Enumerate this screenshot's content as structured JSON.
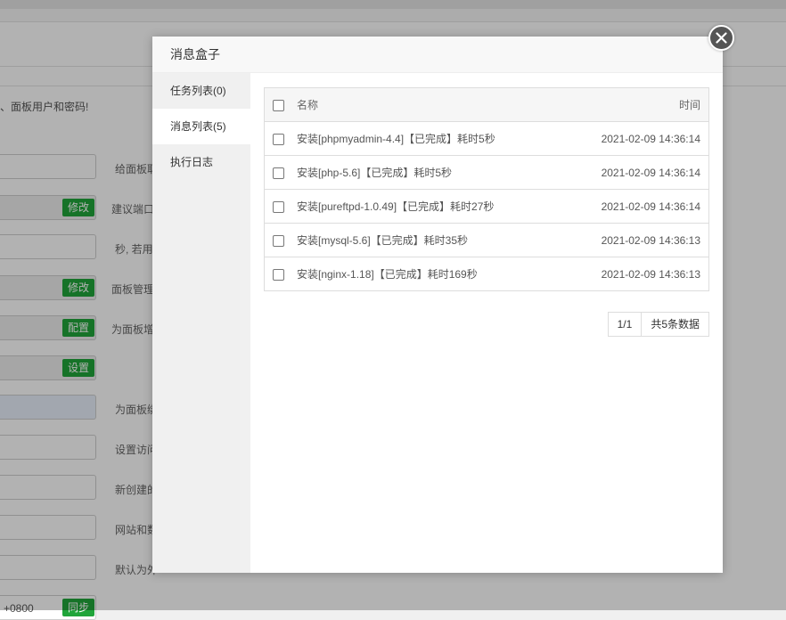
{
  "background": {
    "notice_text": "、面板用户和密码!",
    "buttons": [
      "修改",
      "修改",
      "配置",
      "设置"
    ],
    "partial_button": "同步",
    "hints": [
      "给面板取",
      "建议端口",
      "秒, 若用",
      "面板管理",
      "为面板增",
      "为面板绑",
      "设置访问",
      "新创建的",
      "网站和数",
      "默认为外"
    ],
    "timezone_text": "+0800"
  },
  "modal": {
    "title": "消息盒子",
    "sidebar": [
      {
        "label": "任务列表(0)",
        "active": false
      },
      {
        "label": "消息列表(5)",
        "active": true
      },
      {
        "label": "执行日志",
        "active": false
      }
    ],
    "table": {
      "col_name": "名称",
      "col_time": "时间",
      "rows": [
        {
          "name": "安装[phpmyadmin-4.4]【已完成】耗时5秒",
          "time": "2021-02-09 14:36:14"
        },
        {
          "name": "安装[php-5.6]【已完成】耗时5秒",
          "time": "2021-02-09 14:36:14"
        },
        {
          "name": "安装[pureftpd-1.0.49]【已完成】耗时27秒",
          "time": "2021-02-09 14:36:14"
        },
        {
          "name": "安装[mysql-5.6]【已完成】耗时35秒",
          "time": "2021-02-09 14:36:13"
        },
        {
          "name": "安装[nginx-1.18]【已完成】耗时169秒",
          "time": "2021-02-09 14:36:13"
        }
      ]
    },
    "pager": {
      "current": "1/1",
      "total": "共5条数据"
    }
  },
  "colors": {
    "accent_green": "#20a53a",
    "overlay": "rgba(0,0,0,0.30)"
  },
  "icons": {
    "close": "close-icon"
  }
}
